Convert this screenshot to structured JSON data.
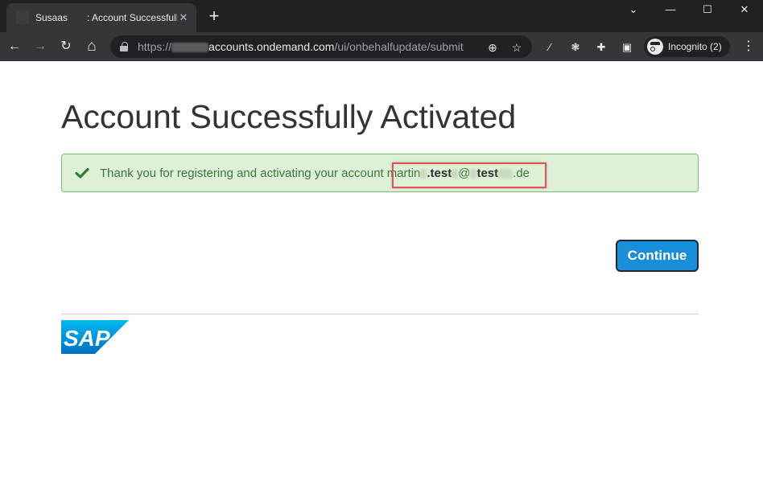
{
  "browser": {
    "tab": {
      "title": "Susaas  : Account Successfully Activated",
      "close": "✕"
    },
    "new_tab": "+",
    "window_controls": {
      "chevron": "⌄",
      "minimize": "—",
      "maximize": "☐",
      "close": "✕"
    },
    "nav": {
      "back": "←",
      "forward": "→",
      "reload": "↻",
      "home": "⌂"
    },
    "url": {
      "scheme": "https://",
      "host": "accounts.ondemand.com",
      "path": "/ui/onbehalfupdate/submit"
    },
    "omnibox_icons": {
      "zoom": "⊕",
      "star": "☆"
    },
    "extensions": {
      "ext1": "⁄",
      "ext2": "❃",
      "puzzle": "✚",
      "sidepanel": "▣"
    },
    "profile_label": "Incognito (2)",
    "menu": "⋮"
  },
  "page": {
    "title": "Account Successfully Activated",
    "alert": {
      "message": "Thank you for registering and activating your account",
      "email": {
        "part1": "martin",
        "part2": ".test",
        "at": "@",
        "part3": "test",
        "suffix": ".de"
      },
      "color": "#dff0d8",
      "icon": "check-icon"
    },
    "continue_label": "Continue",
    "logo_text": "SAP",
    "accent_color": "#1a8ed8"
  }
}
